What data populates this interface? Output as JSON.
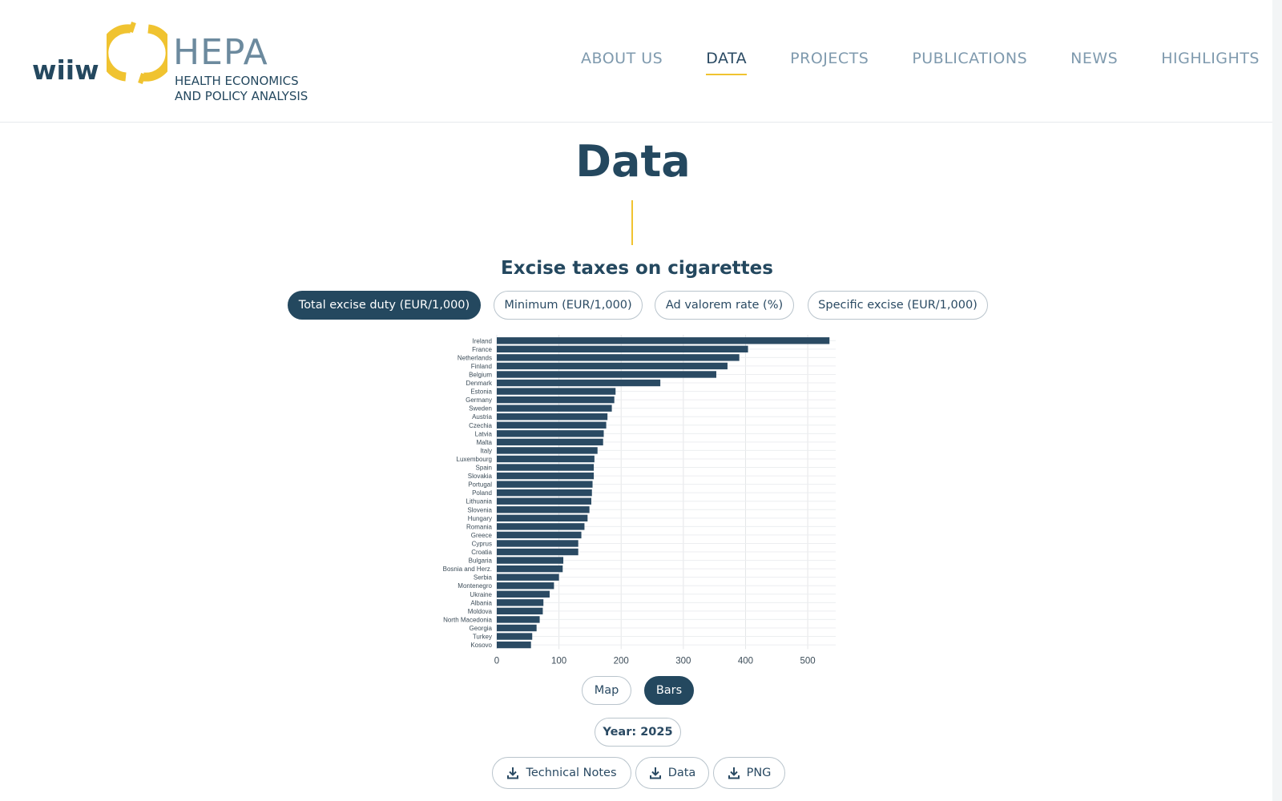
{
  "header": {
    "logo": {
      "wiiw": "wiiw",
      "hepa": "HEPA",
      "subtitle_line1": "HEALTH ECONOMICS",
      "subtitle_line2": "AND POLICY ANALYSIS"
    },
    "nav": [
      {
        "label": "ABOUT US",
        "active": false
      },
      {
        "label": "DATA",
        "active": true
      },
      {
        "label": "PROJECTS",
        "active": false
      },
      {
        "label": "PUBLICATIONS",
        "active": false
      },
      {
        "label": "NEWS",
        "active": false
      },
      {
        "label": "HIGHLIGHTS",
        "active": false
      }
    ]
  },
  "page": {
    "title": "Data",
    "chart_heading": "Excise taxes on cigarettes"
  },
  "measure_tabs": [
    {
      "label": "Total excise duty (EUR/1,000)",
      "active": true
    },
    {
      "label": "Minimum (EUR/1,000)",
      "active": false
    },
    {
      "label": "Ad valorem rate (%)",
      "active": false
    },
    {
      "label": "Specific excise (EUR/1,000)",
      "active": false
    }
  ],
  "view_toggle": {
    "map_label": "Map",
    "bars_label": "Bars",
    "active": "Bars"
  },
  "year_label": "Year: 2025",
  "downloads": {
    "technical_notes": "Technical Notes",
    "data": "Data",
    "png": "PNG"
  },
  "colors": {
    "primary": "#24485f",
    "accent": "#f0c330",
    "nav_inactive": "#7f9aae",
    "bar": "#2a4a63",
    "grid": "#e4e6e8"
  },
  "chart_data": {
    "type": "bar",
    "orientation": "horizontal",
    "categories": [
      "Ireland",
      "France",
      "Netherlands",
      "Finland",
      "Belgium",
      "Denmark",
      "Estonia",
      "Germany",
      "Sweden",
      "Austria",
      "Czechia",
      "Latvia",
      "Malta",
      "Italy",
      "Luxembourg",
      "Spain",
      "Slovakia",
      "Portugal",
      "Poland",
      "Lithuania",
      "Slovenia",
      "Hungary",
      "Romania",
      "Greece",
      "Cyprus",
      "Croatia",
      "Bulgaria",
      "Bosnia and Herz.",
      "Serbia",
      "Montenegro",
      "Ukraine",
      "Albania",
      "Moldova",
      "North Macedonia",
      "Georgia",
      "Turkey",
      "Kosovo"
    ],
    "values": [
      535,
      404,
      390,
      371,
      353,
      263,
      191,
      189,
      185,
      178,
      176,
      172,
      171,
      162,
      157,
      156,
      156,
      154,
      153,
      152,
      149,
      146,
      141,
      136,
      131,
      131,
      107,
      106,
      100,
      92,
      85,
      75,
      74,
      69,
      64,
      57,
      55
    ],
    "xticks": [
      0,
      100,
      200,
      300,
      400,
      500
    ],
    "xlim": [
      0,
      545
    ],
    "grid": true
  }
}
